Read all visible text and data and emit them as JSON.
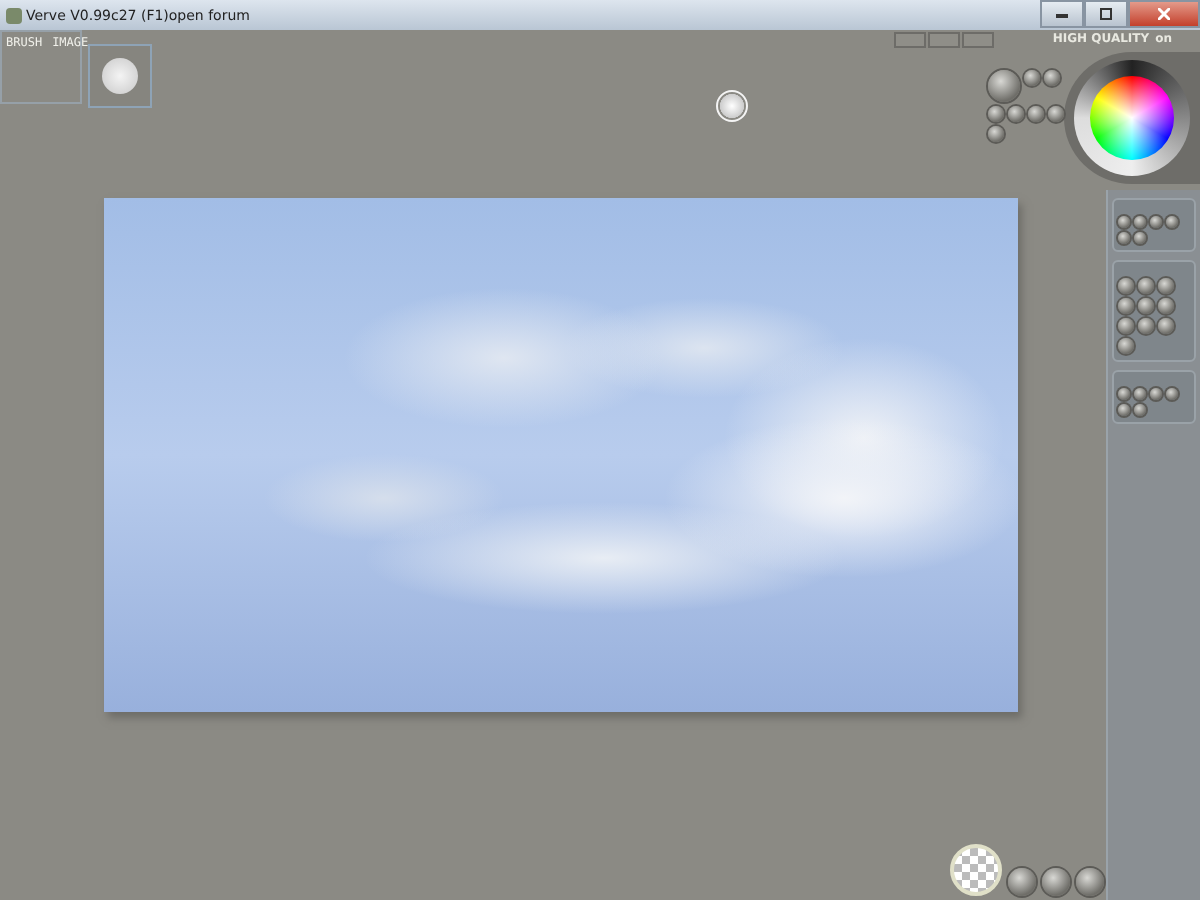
{
  "window": {
    "title": "Verve V0.99c27 (F1)open forum"
  },
  "brush_panel": {
    "tabs": [
      "BRUSH",
      "IMAGE"
    ]
  },
  "color_panel": {
    "quality_label": "HIGH QUALITY",
    "quality_state": "on"
  }
}
